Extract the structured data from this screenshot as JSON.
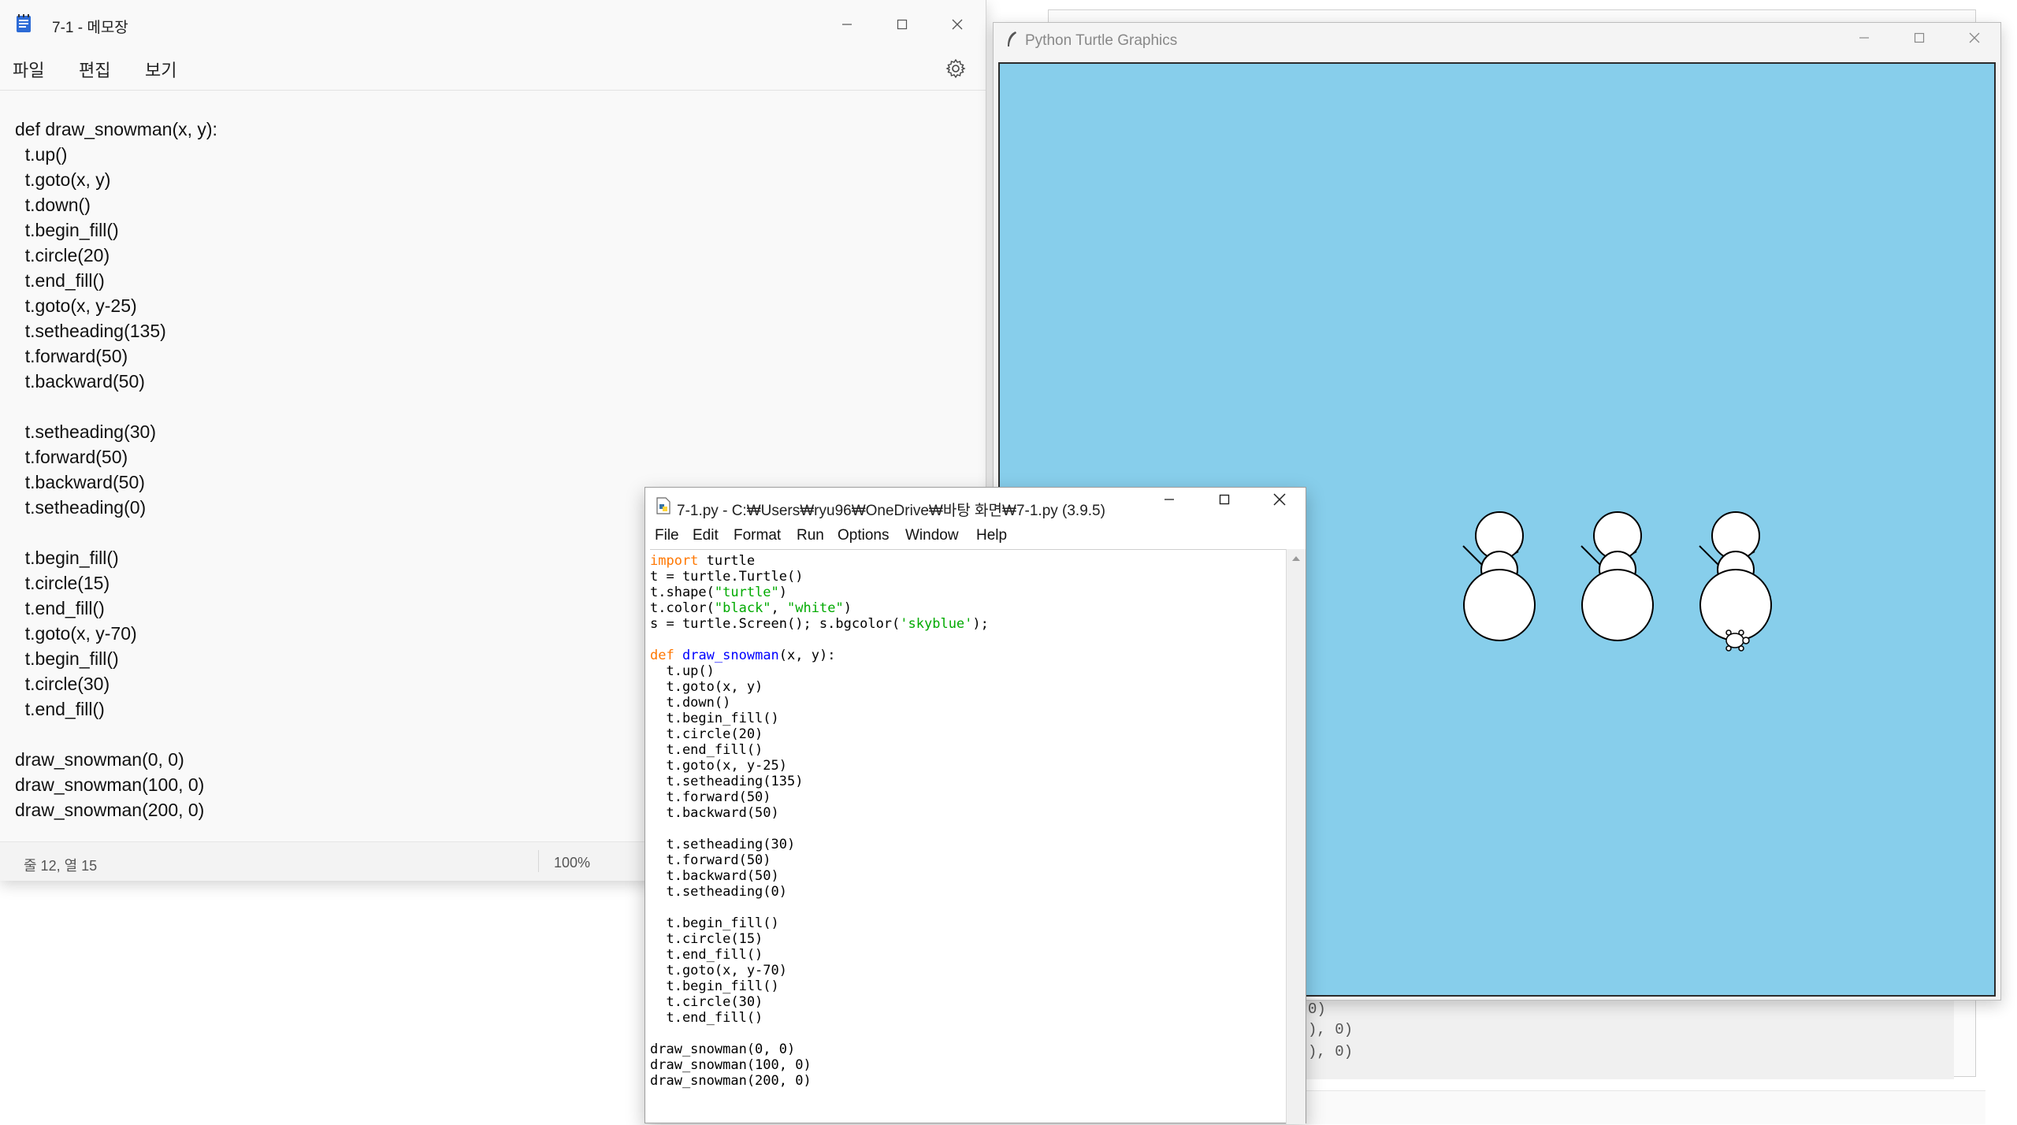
{
  "notepad": {
    "title": "7-1 - 메모장",
    "menu": [
      "파일",
      "편집",
      "보기"
    ],
    "code_lines": [
      "def draw_snowman(x, y):",
      "  t.up()",
      "  t.goto(x, y)",
      "  t.down()",
      "  t.begin_fill()",
      "  t.circle(20)",
      "  t.end_fill()",
      "  t.goto(x, y-25)",
      "  t.setheading(135)",
      "  t.forward(50)",
      "  t.backward(50)",
      "",
      "  t.setheading(30)",
      "  t.forward(50)",
      "  t.backward(50)",
      "  t.setheading(0)",
      "",
      "  t.begin_fill()",
      "  t.circle(15)",
      "  t.end_fill()",
      "  t.goto(x, y-70)",
      "  t.begin_fill()",
      "  t.circle(30)",
      "  t.end_fill()",
      "",
      "draw_snowman(0, 0)",
      "draw_snowman(100, 0)",
      "draw_snowman(200, 0)"
    ],
    "status_position": "줄 12, 열 15",
    "status_zoom": "100%"
  },
  "turtle_window": {
    "title": "Python Turtle Graphics",
    "bgcolor": "#87ceeb"
  },
  "idle": {
    "title": "7-1.py - C:₩Users₩ryu96₩OneDrive₩바탕 화면₩7-1.py (3.9.5)",
    "menu": [
      "File",
      "Edit",
      "Format",
      "Run",
      "Options",
      "Window",
      "Help"
    ],
    "code_lines": [
      [
        {
          "t": "import",
          "c": "kw"
        },
        {
          "t": " turtle",
          "c": ""
        }
      ],
      [
        {
          "t": "t = turtle.Turtle()",
          "c": ""
        }
      ],
      [
        {
          "t": "t.shape(",
          "c": ""
        },
        {
          "t": "\"turtle\"",
          "c": "str"
        },
        {
          "t": ")",
          "c": ""
        }
      ],
      [
        {
          "t": "t.color(",
          "c": ""
        },
        {
          "t": "\"black\"",
          "c": "str"
        },
        {
          "t": ", ",
          "c": ""
        },
        {
          "t": "\"white\"",
          "c": "str"
        },
        {
          "t": ")",
          "c": ""
        }
      ],
      [
        {
          "t": "s = turtle.Screen(); s.bgcolor(",
          "c": ""
        },
        {
          "t": "'skyblue'",
          "c": "str"
        },
        {
          "t": ");",
          "c": ""
        }
      ],
      [
        {
          "t": "",
          "c": ""
        }
      ],
      [
        {
          "t": "def",
          "c": "kw"
        },
        {
          "t": " ",
          "c": ""
        },
        {
          "t": "draw_snowman",
          "c": "def"
        },
        {
          "t": "(x, y):",
          "c": ""
        }
      ],
      [
        {
          "t": "  t.up()",
          "c": ""
        }
      ],
      [
        {
          "t": "  t.goto(x, y)",
          "c": ""
        }
      ],
      [
        {
          "t": "  t.down()",
          "c": ""
        }
      ],
      [
        {
          "t": "  t.begin_fill()",
          "c": ""
        }
      ],
      [
        {
          "t": "  t.circle(20)",
          "c": ""
        }
      ],
      [
        {
          "t": "  t.end_fill()",
          "c": ""
        }
      ],
      [
        {
          "t": "  t.goto(x, y-25)",
          "c": ""
        }
      ],
      [
        {
          "t": "  t.setheading(135)",
          "c": ""
        }
      ],
      [
        {
          "t": "  t.forward(50)",
          "c": ""
        }
      ],
      [
        {
          "t": "  t.backward(50)",
          "c": ""
        }
      ],
      [
        {
          "t": "",
          "c": ""
        }
      ],
      [
        {
          "t": "  t.setheading(30)",
          "c": ""
        }
      ],
      [
        {
          "t": "  t.forward(50)",
          "c": ""
        }
      ],
      [
        {
          "t": "  t.backward(50)",
          "c": ""
        }
      ],
      [
        {
          "t": "  t.setheading(0)",
          "c": ""
        }
      ],
      [
        {
          "t": "",
          "c": ""
        }
      ],
      [
        {
          "t": "  t.begin_fill()",
          "c": ""
        }
      ],
      [
        {
          "t": "  t.circle(15)",
          "c": ""
        }
      ],
      [
        {
          "t": "  t.end_fill()",
          "c": ""
        }
      ],
      [
        {
          "t": "  t.goto(x, y-70)",
          "c": ""
        }
      ],
      [
        {
          "t": "  t.begin_fill()",
          "c": ""
        }
      ],
      [
        {
          "t": "  t.circle(30)",
          "c": ""
        }
      ],
      [
        {
          "t": "  t.end_fill()",
          "c": ""
        }
      ],
      [
        {
          "t": "",
          "c": ""
        }
      ],
      [
        {
          "t": "draw_snowman(0, 0)",
          "c": ""
        }
      ],
      [
        {
          "t": "draw_snowman(100, 0)",
          "c": ""
        }
      ],
      [
        {
          "t": "draw_snowman(200, 0)",
          "c": ""
        }
      ]
    ]
  },
  "background_window": {
    "fragments": [
      "0)",
      "), 0)",
      "), 0)"
    ]
  }
}
